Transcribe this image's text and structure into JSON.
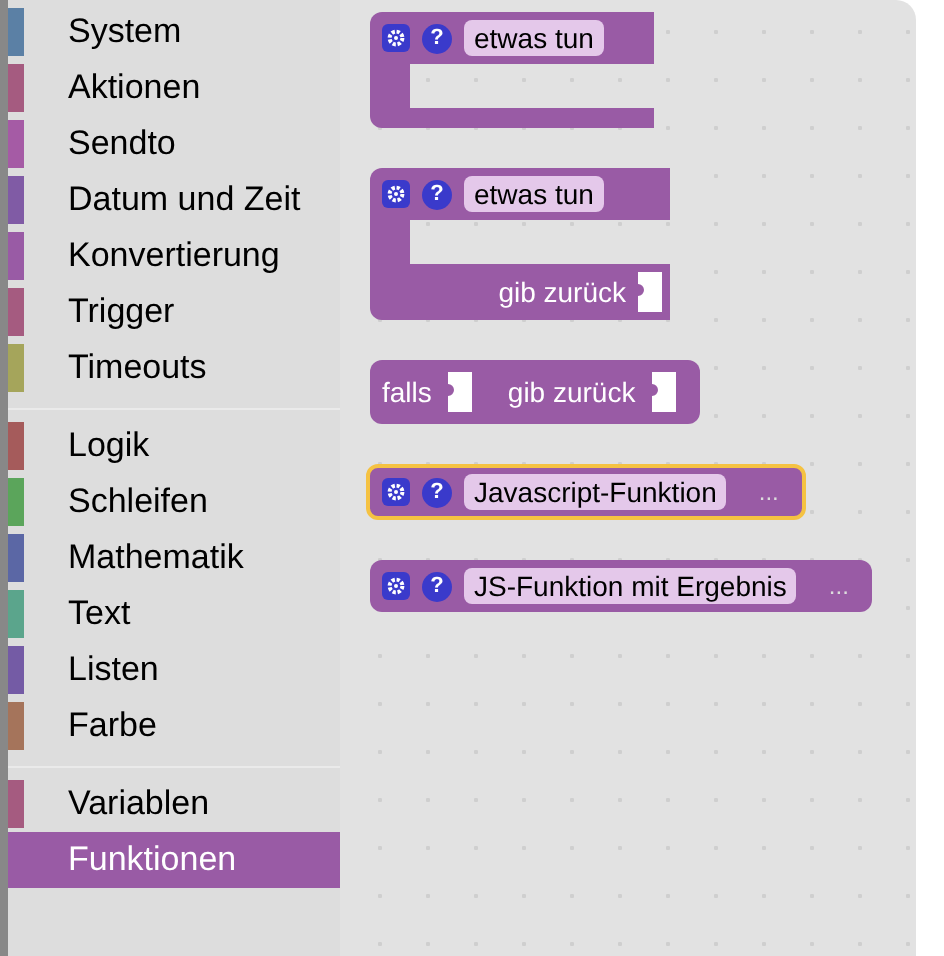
{
  "sidebar": {
    "groups": [
      [
        {
          "label": "System",
          "color": "#5b80a5",
          "selected": false
        },
        {
          "label": "Aktionen",
          "color": "#a55b80",
          "selected": false
        },
        {
          "label": "Sendto",
          "color": "#a55ba5",
          "selected": false
        },
        {
          "label": "Datum und Zeit",
          "color": "#805ba5",
          "selected": false
        },
        {
          "label": "Konvertierung",
          "color": "#995ba5",
          "selected": false
        },
        {
          "label": "Trigger",
          "color": "#a55b80",
          "selected": false
        },
        {
          "label": "Timeouts",
          "color": "#a5a55b",
          "selected": false
        }
      ],
      [
        {
          "label": "Logik",
          "color": "#a55b5b",
          "selected": false
        },
        {
          "label": "Schleifen",
          "color": "#5ba55b",
          "selected": false
        },
        {
          "label": "Mathematik",
          "color": "#5b67a5",
          "selected": false
        },
        {
          "label": "Text",
          "color": "#5ba58c",
          "selected": false
        },
        {
          "label": "Listen",
          "color": "#745ba5",
          "selected": false
        },
        {
          "label": "Farbe",
          "color": "#a5745b",
          "selected": false
        }
      ],
      [
        {
          "label": "Variablen",
          "color": "#a55b80",
          "selected": false
        },
        {
          "label": "Funktionen",
          "color": "#995ba5",
          "selected": true
        }
      ]
    ]
  },
  "flyout": {
    "blocks": [
      {
        "kind": "procedure",
        "help": "?",
        "name": "etwas tun",
        "selected": false
      },
      {
        "kind": "procedure-return",
        "help": "?",
        "name": "etwas tun",
        "return_label": "gib zurück",
        "selected": false
      },
      {
        "kind": "if-return",
        "label": "falls",
        "return_label": "gib zurück",
        "selected": false
      },
      {
        "kind": "javascript",
        "help": "?",
        "name": "Javascript-Funktion",
        "more": "...",
        "selected": true
      },
      {
        "kind": "javascript",
        "help": "?",
        "name": "JS-Funktion mit Ergebnis",
        "more": "...",
        "selected": false
      }
    ]
  }
}
